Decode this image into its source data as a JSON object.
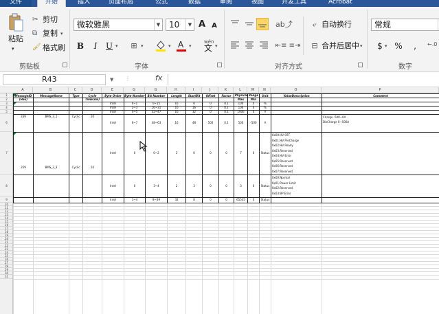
{
  "tabs": [
    {
      "label": "文件"
    },
    {
      "label": "开始"
    },
    {
      "label": "插入"
    },
    {
      "label": "页面布局"
    },
    {
      "label": "公式"
    },
    {
      "label": "数据"
    },
    {
      "label": "审阅"
    },
    {
      "label": "视图"
    },
    {
      "label": "开发工具"
    },
    {
      "label": "Acrobat"
    }
  ],
  "clipboard": {
    "paste": "粘贴",
    "cut": "剪切",
    "copy": "复制",
    "format_painter": "格式刷",
    "group": "剪贴板"
  },
  "font": {
    "name": "微软雅黑",
    "size": "10",
    "bold": "B",
    "italic": "I",
    "underline": "U",
    "group": "字体",
    "inc": "A",
    "dec": "A",
    "phonetic": "wén"
  },
  "alignment": {
    "wrap": "自动换行",
    "merge": "合并后居中",
    "group": "对齐方式"
  },
  "number": {
    "format": "常规",
    "group": "数字",
    "currency": "$",
    "percent": "%",
    "comma": ","
  },
  "formula_bar": {
    "name_box": "R43",
    "fx": "fx",
    "content": ""
  },
  "columns": [
    "A",
    "B",
    "C",
    "D",
    "E",
    "G",
    "G",
    "H",
    "I",
    "J",
    "K",
    "L",
    "M",
    "N",
    "O",
    "P",
    "Q"
  ],
  "rows": [
    "1",
    "2",
    "3",
    "4",
    "5",
    "6",
    "7",
    "8",
    "9",
    "10",
    "11",
    "12",
    "13",
    "14",
    "15",
    "16",
    "17",
    "18",
    "19",
    "20",
    "21",
    "22",
    "23",
    "24",
    "25",
    "26",
    "27",
    "28",
    "29",
    "30",
    "31"
  ],
  "headers": {
    "message_id": "MessageID (Hex)",
    "message_name": "MessageName",
    "type": "Type",
    "cycle": "Cycle Time(ms)",
    "byte_order": "Byte Order",
    "byte_number": "Byte Number",
    "bit_number": "Bit Number",
    "length": "Length",
    "start_bit": "StartBit",
    "offset": "Offset",
    "factor": "Factor",
    "range": "Physical Range",
    "max": "Max",
    "min": "Min",
    "unit": "Unit",
    "value_desc": "ValueDescription",
    "comment": "Comment"
  },
  "msg1": {
    "id": "339",
    "name": "BMS_3_1",
    "type": "Cyclic",
    "cycle": "20"
  },
  "msg1_rows": [
    {
      "order": "Intel",
      "byte": "0~1",
      "bit": "0~15",
      "len": "16",
      "start": "0",
      "offset": "0",
      "factor": "0.1",
      "max": "100",
      "min": "0",
      "unit": "%"
    },
    {
      "order": "Intel",
      "byte": "2~3",
      "bit": "16~31",
      "len": "16",
      "start": "16",
      "offset": "0",
      "factor": "0.1",
      "max": "100",
      "min": "0",
      "unit": "%"
    },
    {
      "order": "Intel",
      "byte": "4~5",
      "bit": "32~47",
      "len": "16",
      "start": "32",
      "offset": "0",
      "factor": "0.1",
      "max": "1000",
      "min": "0",
      "unit": "V"
    },
    {
      "order": "Intel",
      "byte": "6~7",
      "bit": "48~63",
      "len": "16",
      "start": "48",
      "offset": "500",
      "factor": "0.1",
      "max": "500",
      "min": "-500",
      "unit": "A"
    }
  ],
  "msg1_comment": [
    "Charge -500~0A",
    "DisCharge 0~500A"
  ],
  "msg2": {
    "id": "359",
    "name": "BMS_3_3",
    "type": "Cyclic",
    "cycle": "20"
  },
  "msg2_rows": [
    {
      "order": "Intel",
      "byte": "0",
      "bit": "0~2",
      "len": "3",
      "start": "0",
      "offset": "0",
      "factor": "0",
      "max": "7",
      "min": "0",
      "unit": "Status"
    },
    {
      "order": "Intel",
      "byte": "0",
      "bit": "3~4",
      "len": "2",
      "start": "3",
      "offset": "0",
      "factor": "0",
      "max": "3",
      "min": "0",
      "unit": "Status"
    },
    {
      "order": "Intel",
      "byte": "1~4",
      "bit": "8~39",
      "len": "32",
      "start": "8",
      "offset": "0",
      "factor": "0",
      "max": "65535",
      "min": "0",
      "unit": "Status"
    }
  ],
  "msg2_desc1": [
    "0x00:HV OFF",
    "0x01:HV PreCharge",
    "0x02:HV Ready",
    "0x03:Reserved",
    "0x04:HV Error",
    "0x05:Reserved",
    "0x06:Reserved",
    "0x07:Reserved"
  ],
  "msg2_desc2": [
    "0x00:Normal",
    "0x01:Power Limit",
    "0x02:Reserved",
    "0x03:BP Error"
  ]
}
